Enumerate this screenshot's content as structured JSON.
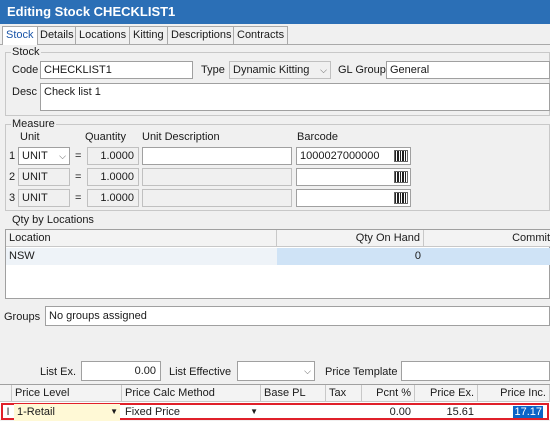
{
  "window": {
    "title": "Editing Stock CHECKLIST1"
  },
  "tabs": [
    "Stock",
    "Details",
    "Locations",
    "Kitting",
    "Descriptions",
    "Contracts"
  ],
  "stock": {
    "group_label": "Stock",
    "code_label": "Code",
    "code_value": "CHECKLIST1",
    "type_label": "Type",
    "type_value": "Dynamic Kitting",
    "gl_group_label": "GL Group",
    "gl_group_value": "General",
    "desc_label": "Desc",
    "desc_value": "Check list 1"
  },
  "measure": {
    "group_label": "Measure",
    "headers": {
      "unit": "Unit",
      "quantity": "Quantity",
      "unit_description": "Unit Description",
      "barcode": "Barcode"
    },
    "rows": [
      {
        "num": "1",
        "unit": "UNIT",
        "eq": "=",
        "quantity": "1.0000",
        "unit_description": "",
        "barcode": "1000027000000"
      },
      {
        "num": "2",
        "unit": "UNIT",
        "eq": "=",
        "quantity": "1.0000",
        "unit_description": "",
        "barcode": ""
      },
      {
        "num": "3",
        "unit": "UNIT",
        "eq": "=",
        "quantity": "1.0000",
        "unit_description": "",
        "barcode": ""
      }
    ]
  },
  "qty_by_locations": {
    "group_label": "Qty by Locations",
    "headers": {
      "location": "Location",
      "qty_on_hand": "Qty On Hand",
      "committed": "Commit"
    },
    "rows": [
      {
        "location": "NSW",
        "qty_on_hand": "0",
        "committed": ""
      }
    ]
  },
  "groups": {
    "label": "Groups",
    "value": "No groups assigned"
  },
  "pricing": {
    "list_ex_label": "List Ex.",
    "list_ex_value": "0.00",
    "list_effective_label": "List Effective",
    "list_effective_value": "",
    "price_template_label": "Price Template",
    "price_template_value": "",
    "headers": [
      "Price Level",
      "Price Calc Method",
      "Base PL",
      "Tax",
      "Pcnt %",
      "Price Ex.",
      "Price Inc."
    ],
    "rows": [
      {
        "marker": "I",
        "price_level": "1-Retail",
        "calc_method": "Fixed Price",
        "base_pl": "",
        "tax": "",
        "pcnt": "0.00",
        "price_ex": "15.61",
        "price_inc": "17.17"
      }
    ]
  },
  "colors": {
    "title_bar": "#2b6fb6",
    "selection": "#0a64c8",
    "location_highlight": "#cfe3f6",
    "row_highlight_border": "#e0202a"
  }
}
